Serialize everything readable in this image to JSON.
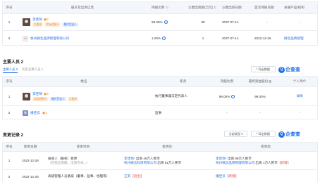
{
  "shareholders": {
    "headers": [
      "序号",
      "股东及出资信息",
      "持股比例",
      "认缴出资额(万元)",
      "认缴出资日期",
      "首次持股日期",
      "关联产品/机构"
    ],
    "rows": [
      {
        "index": "1",
        "name": "李佳琦",
        "badge": "3",
        "tags": [
          "大股东",
          "实际控制人",
          "最终受益人"
        ],
        "ratio": "99.00%",
        "amount": "99",
        "subscribe_date": "2037-07-14",
        "first_date": "-",
        "related": "-"
      },
      {
        "index": "2",
        "name": "杭州微念品牌管理有限公司",
        "badge": "",
        "tags": [],
        "ratio": "1.00%",
        "amount": "1",
        "subscribe_date": "2037-07-14",
        "first_date": "2022-12-26",
        "related": "微念品牌管理"
      }
    ]
  },
  "staff": {
    "title": "主要人员 2",
    "tabs": [
      "主要人员 2",
      "历史主要人员 1"
    ],
    "export_label": "导出数据",
    "logo_text": "企查查",
    "headers": [
      "序号",
      "姓名",
      "职务",
      "持股比例",
      "最终受益股份",
      "个人简介"
    ],
    "rows": [
      {
        "index": "1",
        "name": "李佳琦",
        "badge": "3",
        "tags": [
          "实际控制人",
          "最终受益人",
          "大股东"
        ],
        "role": "执行董事兼法定代表人",
        "ratio": "99.00%",
        "benefit": "99.00%",
        "bio": "详情"
      },
      {
        "index": "2",
        "name": "播佳云",
        "badge": "1",
        "tags": [],
        "role": "监事",
        "ratio": "-",
        "benefit": "-",
        "bio": "-"
      }
    ]
  },
  "changes": {
    "title": "变更记录 2",
    "filter_label": "全部类型",
    "export_label": "导出数据",
    "logo_text": "企查查",
    "headers": [
      "序号",
      "变更日期",
      "变更项目",
      "变更前",
      "变更后"
    ],
    "rows": [
      {
        "index": "1",
        "date": "2022-12-26",
        "item": "投资人（股权）变更",
        "item2": "（包括出资额、出资方式...）",
        "before1": "李佳琦*",
        "before1b": "出资 49万人民币",
        "before2": "杭州微念科技有限公司",
        "before2b": "出资 51万人民币",
        "after1": "李佳琦*",
        "after1b": "出资 99万人民币",
        "after2": "杭州微念品牌管理有限公司",
        "after2b": "出资 1万人民币",
        "after_tag": "【新增】"
      },
      {
        "index": "2",
        "date": "2022-12-26",
        "item": "高级管理人员备案（董事、监事、经理等）",
        "before1": "王莉",
        "before1_tag": "【退出】",
        "after1": "播佳云",
        "after1_tag": "【新增】"
      }
    ]
  }
}
